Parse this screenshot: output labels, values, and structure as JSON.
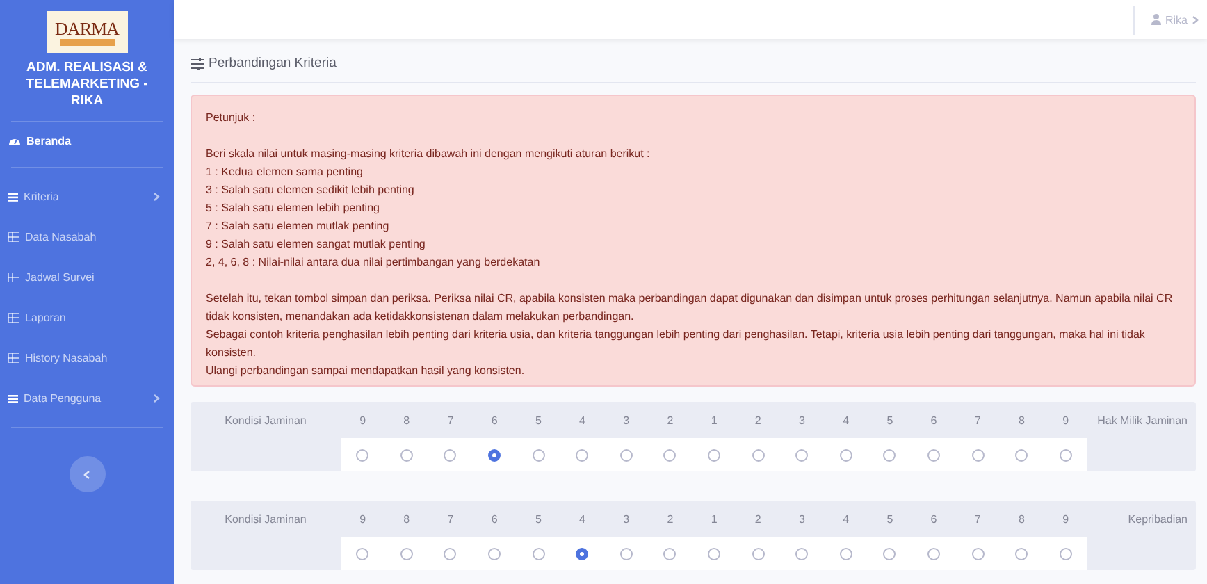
{
  "sidebar": {
    "brand": "DARMA",
    "title": "ADM. REALISASI & TELEMARKETING - RIKA",
    "items": [
      {
        "label": "Beranda",
        "kind": "home",
        "selected": true
      },
      {
        "label": "Kriteria",
        "kind": "menu",
        "selected": false
      },
      {
        "label": "Data Nasabah",
        "kind": "link",
        "selected": false
      },
      {
        "label": "Jadwal Survei",
        "kind": "link",
        "selected": false
      },
      {
        "label": "Laporan",
        "kind": "link",
        "selected": false
      },
      {
        "label": "History Nasabah",
        "kind": "link",
        "selected": false
      },
      {
        "label": "Data Pengguna",
        "kind": "menu",
        "selected": false
      }
    ]
  },
  "topbar": {
    "user": "Rika"
  },
  "page_title": "Perbandingan Kriteria",
  "alert": {
    "heading": "Petunjuk :",
    "intro": "Beri skala nilai untuk masing-masing kriteria dibawah ini dengan mengikuti aturan berikut :",
    "rules": [
      "1 : Kedua elemen sama penting",
      "3 : Salah satu elemen sedikit lebih penting",
      "5 : Salah satu elemen lebih penting",
      "7 : Salah satu elemen mutlak penting",
      "9 : Salah satu elemen sangat mutlak penting",
      "2, 4, 6, 8 : Nilai-nilai antara dua nilai pertimbangan yang berdekatan"
    ],
    "paragraphs": [
      "Setelah itu, tekan tombol simpan dan periksa. Periksa nilai CR, apabila konsisten maka perbandingan dapat digunakan dan disimpan untuk proses perhitungan selanjutnya. Namun apabila nilai CR tidak konsisten, menandakan ada ketidakkonsistenan dalam melakukan perbandingan.",
      "Sebagai contoh kriteria penghasilan lebih penting dari kriteria usia, dan kriteria tanggungan lebih penting dari penghasilan. Tetapi, kriteria usia lebih penting dari tanggungan, maka hal ini tidak konsisten.",
      "Ulangi perbandingan sampai mendapatkan hasil yang konsisten."
    ]
  },
  "comparisons": [
    {
      "left": "Kondisi Jaminan",
      "right": "Hak Milik Jaminan",
      "options": [
        {
          "label": "9",
          "selected": false
        },
        {
          "label": "8",
          "selected": false
        },
        {
          "label": "7",
          "selected": false
        },
        {
          "label": "6",
          "selected": true
        },
        {
          "label": "5",
          "selected": false
        },
        {
          "label": "4",
          "selected": false
        },
        {
          "label": "3",
          "selected": false
        },
        {
          "label": "2",
          "selected": false
        },
        {
          "label": "1",
          "selected": false
        },
        {
          "label": "2",
          "selected": false
        },
        {
          "label": "3",
          "selected": false
        },
        {
          "label": "4",
          "selected": false
        },
        {
          "label": "5",
          "selected": false
        },
        {
          "label": "6",
          "selected": false
        },
        {
          "label": "7",
          "selected": false
        },
        {
          "label": "8",
          "selected": false
        },
        {
          "label": "9",
          "selected": false
        }
      ]
    },
    {
      "left": "Kondisi Jaminan",
      "right": "Kepribadian",
      "options": [
        {
          "label": "9",
          "selected": false
        },
        {
          "label": "8",
          "selected": false
        },
        {
          "label": "7",
          "selected": false
        },
        {
          "label": "6",
          "selected": false
        },
        {
          "label": "5",
          "selected": false
        },
        {
          "label": "4",
          "selected": true
        },
        {
          "label": "3",
          "selected": false
        },
        {
          "label": "2",
          "selected": false
        },
        {
          "label": "1",
          "selected": false
        },
        {
          "label": "2",
          "selected": false
        },
        {
          "label": "3",
          "selected": false
        },
        {
          "label": "4",
          "selected": false
        },
        {
          "label": "5",
          "selected": false
        },
        {
          "label": "6",
          "selected": false
        },
        {
          "label": "7",
          "selected": false
        },
        {
          "label": "8",
          "selected": false
        },
        {
          "label": "9",
          "selected": false
        }
      ]
    }
  ]
}
